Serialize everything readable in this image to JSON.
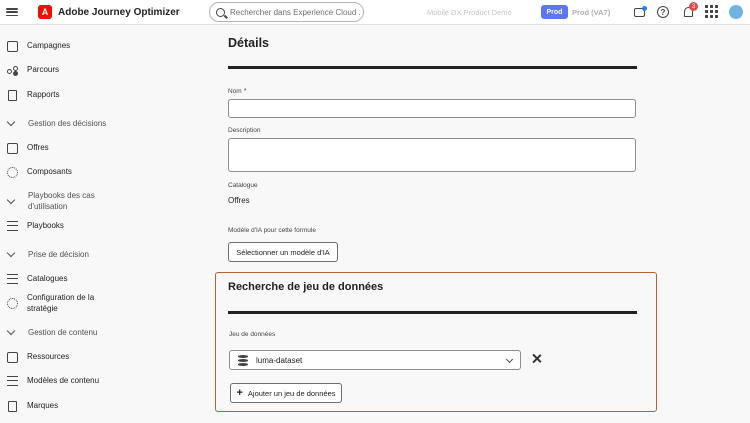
{
  "header": {
    "app_title": "Adobe Journey Optimizer",
    "logo_letter": "A",
    "search_placeholder": "Rechercher dans Experience Cloud ...",
    "org_name": "Mobile DX Product Demo",
    "sandbox_badge": "Prod",
    "sandbox_name": "Prod (VA7)",
    "notification_count": "3"
  },
  "sidebar": {
    "items": [
      {
        "label": "Campagnes",
        "icon": "campaign-icon"
      },
      {
        "label": "Parcours",
        "icon": "journey-icon"
      },
      {
        "label": "Rapports",
        "icon": "report-icon"
      },
      {
        "section": "Gestion des décisions"
      },
      {
        "label": "Offres",
        "icon": "offers-icon"
      },
      {
        "label": "Composants",
        "icon": "components-icon"
      },
      {
        "section_line1": "Playbooks des cas",
        "section_line2": "d'utilisation"
      },
      {
        "label": "Playbooks",
        "icon": "playbooks-icon"
      },
      {
        "section": "Prise de décision"
      },
      {
        "label": "Catalogues",
        "icon": "catalog-icon"
      },
      {
        "label_line1": "Configuration de la",
        "label_line2": "stratégie",
        "icon": "strategy-icon"
      },
      {
        "section": "Gestion de contenu"
      },
      {
        "label": "Ressources",
        "icon": "assets-icon"
      },
      {
        "label": "Modèles de contenu",
        "icon": "templates-icon"
      },
      {
        "label": "Marques",
        "icon": "brands-icon"
      }
    ]
  },
  "details": {
    "heading": "Détails",
    "name_label": "Nom",
    "required_mark": "*",
    "name_value": "",
    "description_label": "Description",
    "description_value": "",
    "catalog_label": "Catalogue",
    "catalog_value": "Offres",
    "ai_model_label": "Modèle d'IA pour cette formule",
    "ai_model_button": "Sélectionner un modèle d'IA"
  },
  "dataset_search": {
    "heading": "Recherche de jeu de données",
    "dataset_label": "Jeu de données",
    "selected_dataset": "luma-dataset",
    "add_button": "Ajouter un jeu de données",
    "accent_color": "#b5603a"
  }
}
